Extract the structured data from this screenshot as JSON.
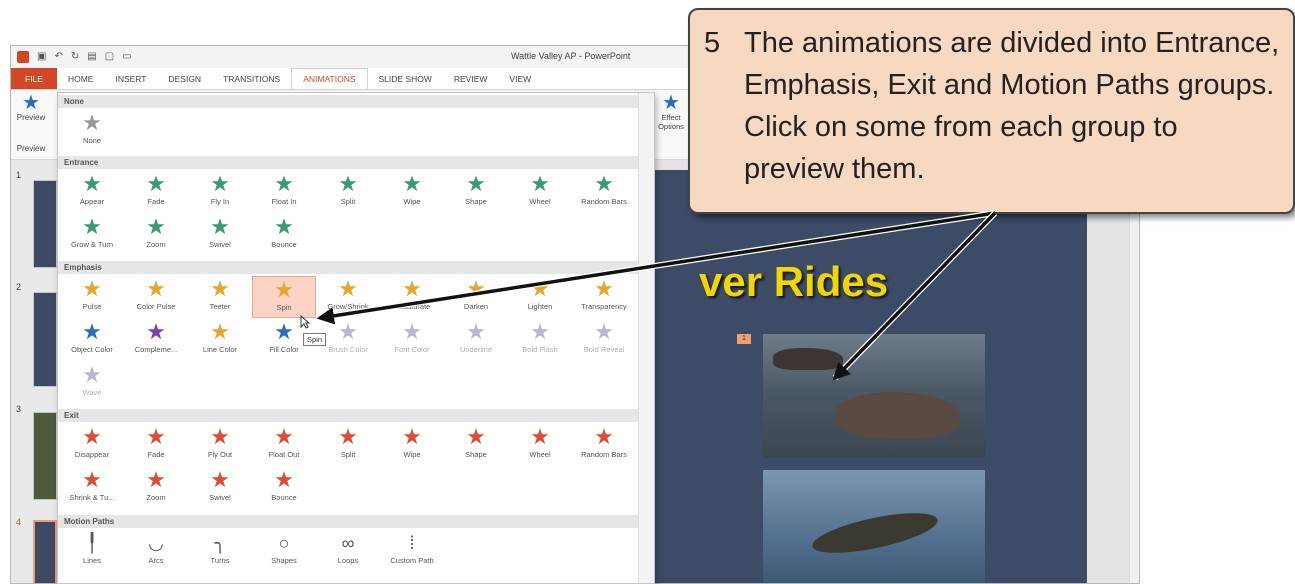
{
  "window": {
    "title": "Wattle Valley AP - PowerPoint",
    "tabs": [
      "FILE",
      "HOME",
      "INSERT",
      "DESIGN",
      "TRANSITIONS",
      "ANIMATIONS",
      "SLIDE SHOW",
      "REVIEW",
      "VIEW"
    ],
    "active_tab": "ANIMATIONS",
    "preview_label": "Preview",
    "preview_group": "Preview",
    "effect_options_label": "Effect Options"
  },
  "thumbs": [
    "1",
    "2",
    "3",
    "4"
  ],
  "slide": {
    "title": "ver Rides",
    "anim_badge": "1"
  },
  "gallery": {
    "none_header": "None",
    "none_item": "None",
    "entrance_header": "Entrance",
    "entrance": [
      "Appear",
      "Fade",
      "Fly In",
      "Float In",
      "Split",
      "Wipe",
      "Shape",
      "Wheel",
      "Random Bars",
      "Grow & Turn",
      "Zoom",
      "Swivel",
      "Bounce"
    ],
    "emphasis_header": "Emphasis",
    "emphasis": [
      "Pulse",
      "Color Pulse",
      "Teeter",
      "Spin",
      "Grow/Shrink",
      "Desaturate",
      "Darken",
      "Lighten",
      "Transparency",
      "Object Color",
      "Compleme...",
      "Line Color",
      "Fill Color",
      "Brush Color",
      "Font Color",
      "Underline",
      "Bold Flash",
      "Bold Reveal",
      "Wave"
    ],
    "exit_header": "Exit",
    "exit": [
      "Disappear",
      "Fade",
      "Fly Out",
      "Float Out",
      "Split",
      "Wipe",
      "Shape",
      "Wheel",
      "Random Bars",
      "Shrink & Tu...",
      "Zoom",
      "Swivel",
      "Bounce"
    ],
    "motion_header": "Motion Paths",
    "motion": [
      "Lines",
      "Arcs",
      "Turns",
      "Shapes",
      "Loops",
      "Custom Path"
    ],
    "selected": "Spin",
    "tooltip": "Spin"
  },
  "callout": {
    "number": "5",
    "text": "The animations are divided into Entrance, Emphasis, Exit and Motion Paths groups.  Click on some from each group to preview them."
  },
  "colors": {
    "entrance": "#3a9a6e",
    "emphasis": "#e6a52e",
    "exit": "#d9502f",
    "file_tab": "#d24726",
    "callout": "#f7d9c2",
    "slide_bg": "#3c4b66",
    "slide_title": "#f2d600"
  }
}
